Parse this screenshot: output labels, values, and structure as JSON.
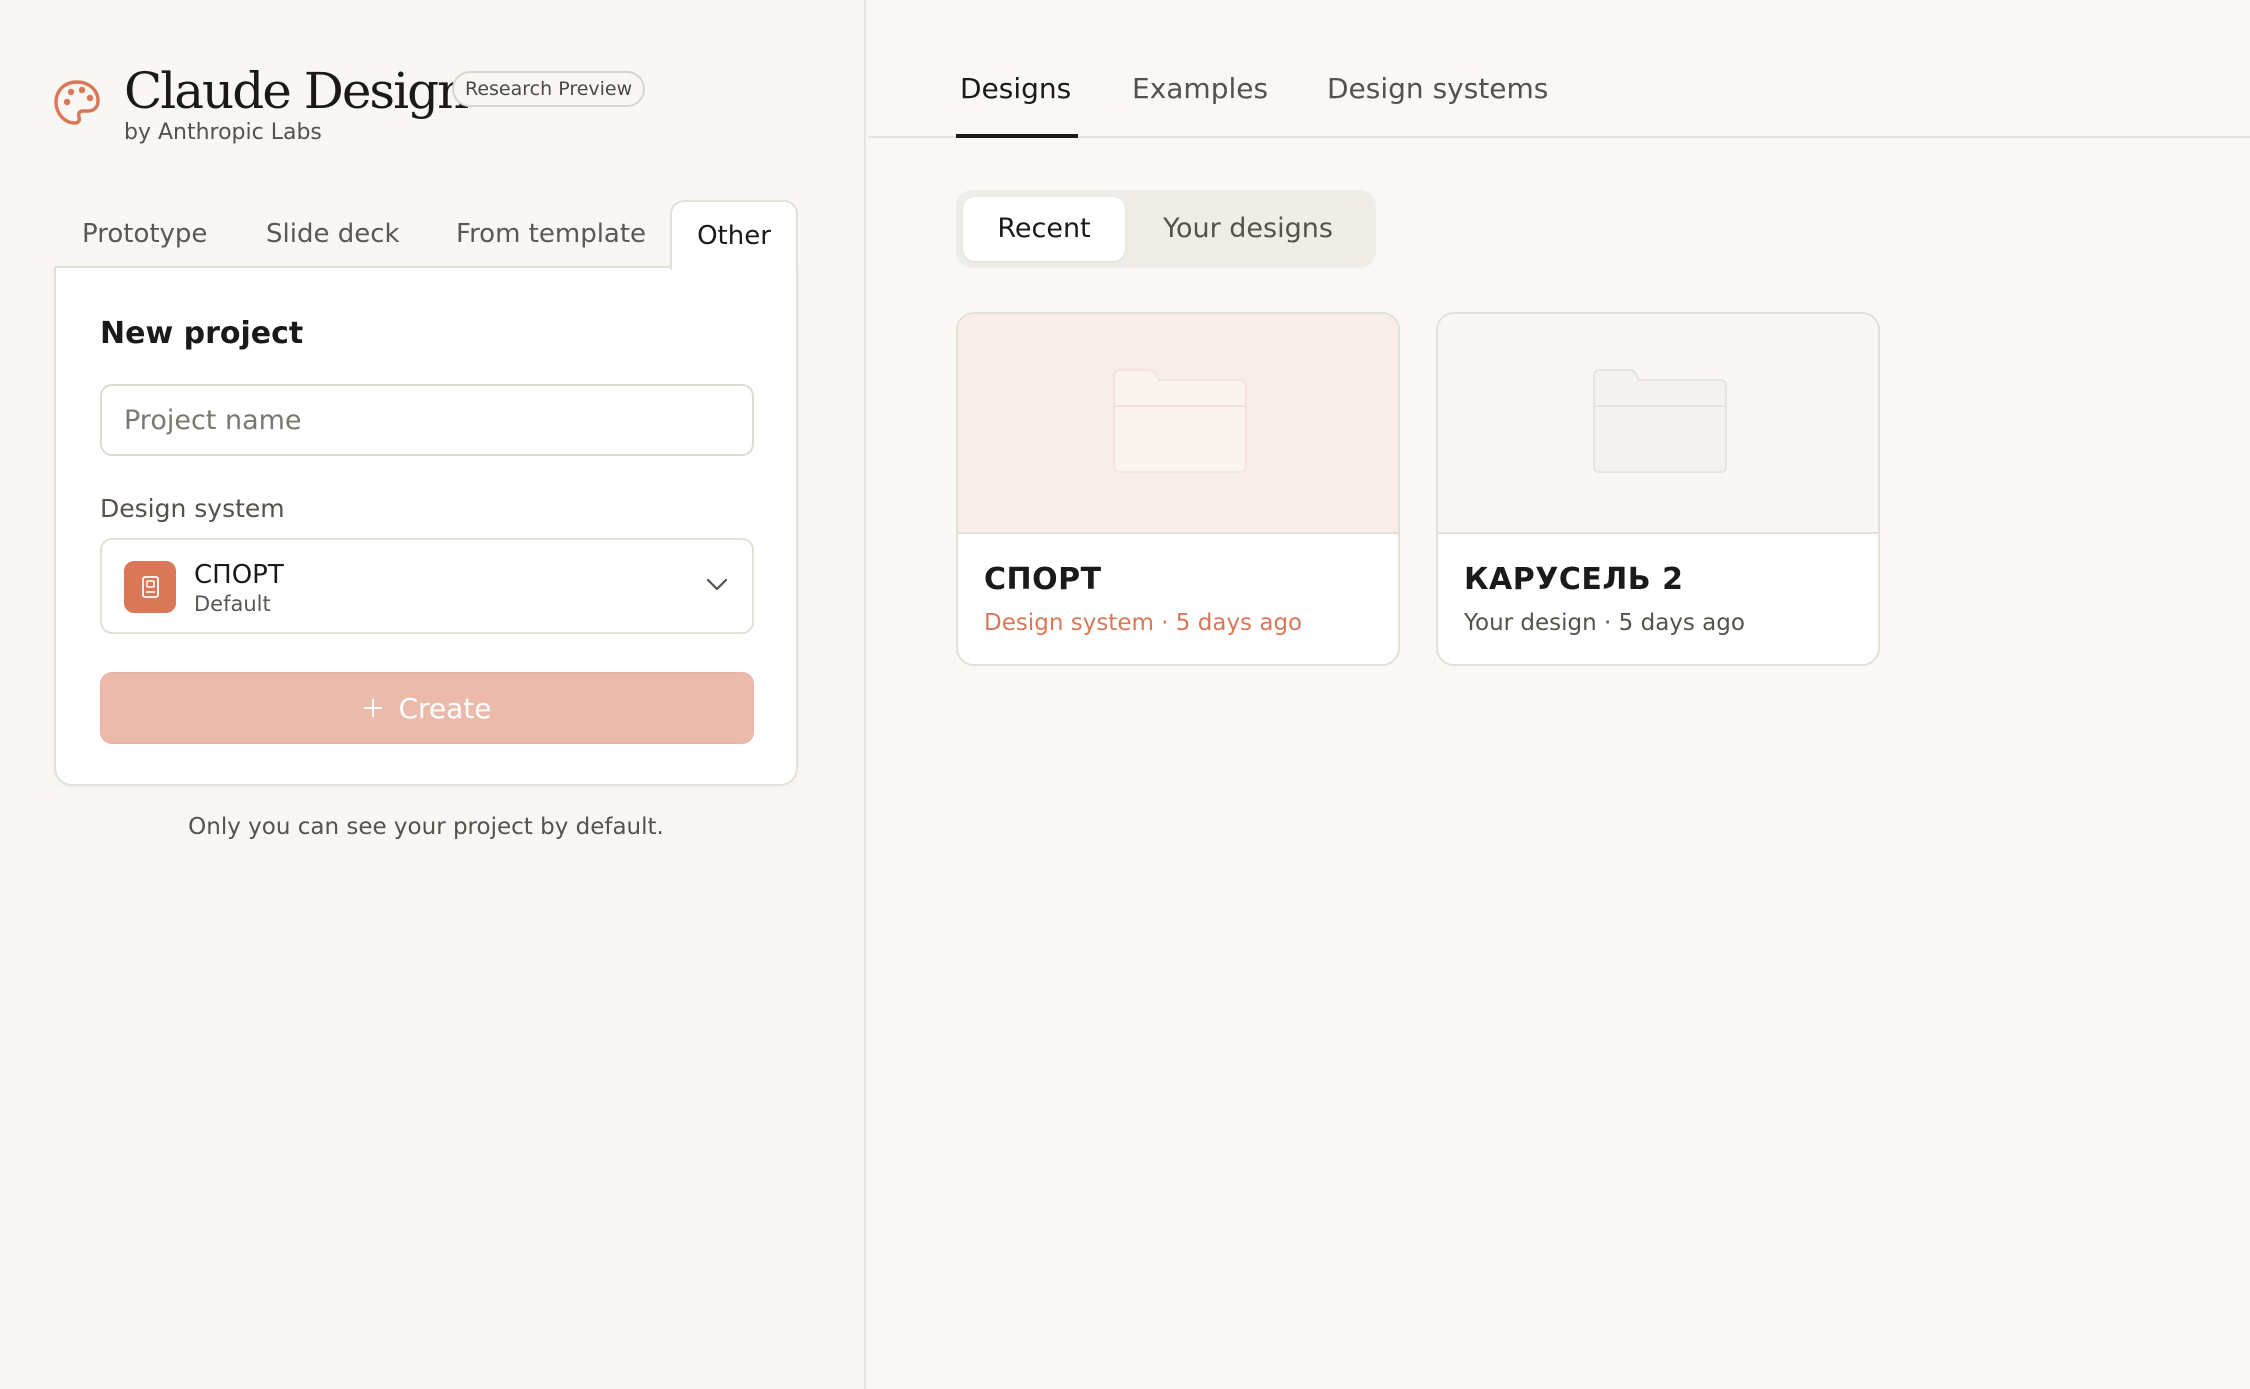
{
  "brand": {
    "title": "Claude Design",
    "badge": "Research Preview",
    "subtitle": "by Anthropic Labs",
    "icon": "palette-icon",
    "accent": "#d97757"
  },
  "left_tabs": [
    {
      "label": "Prototype",
      "active": false
    },
    {
      "label": "Slide deck",
      "active": false
    },
    {
      "label": "From template",
      "active": false
    },
    {
      "label": "Other",
      "active": true
    }
  ],
  "new_project": {
    "title": "New project",
    "name_placeholder": "Project name",
    "name_value": "",
    "design_system_label": "Design system",
    "design_system": {
      "name": "СПОРТ",
      "sub": "Default",
      "icon": "book-icon",
      "swatch": "#d97757"
    },
    "create_label": "Create",
    "privacy_note": "Only you can see your project by default."
  },
  "right_tabs": [
    {
      "label": "Designs",
      "active": true
    },
    {
      "label": "Examples",
      "active": false
    },
    {
      "label": "Design systems",
      "active": false
    }
  ],
  "filter": [
    {
      "label": "Recent",
      "active": true
    },
    {
      "label": "Your designs",
      "active": false
    }
  ],
  "projects": [
    {
      "name": "СПОРТ",
      "meta": "Design system · 5 days ago",
      "thumb_bg": "#f8ede9",
      "meta_color": "#d97757",
      "icon": "folder-icon"
    },
    {
      "name": "КАРУСЕЛЬ 2",
      "meta": "Your design · 5 days ago",
      "thumb_bg": "#f8f7f3",
      "meta_color": "#55524c",
      "icon": "folder-icon"
    }
  ]
}
